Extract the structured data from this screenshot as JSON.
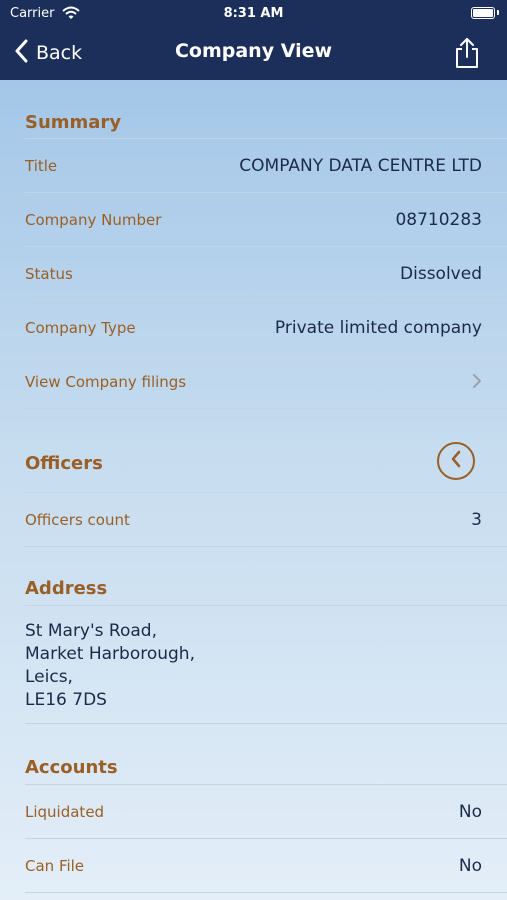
{
  "status_bar": {
    "carrier": "Carrier",
    "time": "8:31 AM"
  },
  "nav": {
    "back_label": "Back",
    "title": "Company View"
  },
  "summary": {
    "header": "Summary",
    "rows": [
      {
        "label": "Title",
        "value": "COMPANY DATA CENTRE LTD"
      },
      {
        "label": "Company Number",
        "value": "08710283"
      },
      {
        "label": "Status",
        "value": "Dissolved"
      },
      {
        "label": "Company Type",
        "value": "Private limited company"
      }
    ],
    "filings_label": "View Company filings"
  },
  "officers": {
    "header": "Officers",
    "count_label": "Officers count",
    "count_value": "3"
  },
  "address": {
    "header": "Address",
    "lines": [
      "St Mary's Road,",
      "Market Harborough,",
      "Leics,",
      "LE16 7DS"
    ]
  },
  "accounts": {
    "header": "Accounts",
    "rows": [
      {
        "label": "Liquidated",
        "value": "No"
      },
      {
        "label": "Can File",
        "value": "No"
      }
    ]
  },
  "colors": {
    "nav_background": "#1b2f5a",
    "label_accent": "#9a5f26",
    "value_text": "#1c2a4a"
  }
}
